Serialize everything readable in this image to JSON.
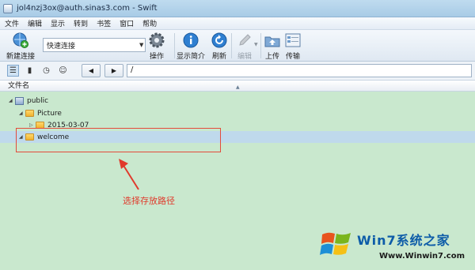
{
  "window": {
    "title": "jol4nzj3ox@auth.sinas3.com - Swift"
  },
  "menu": [
    "文件",
    "编辑",
    "显示",
    "转到",
    "书签",
    "窗口",
    "帮助"
  ],
  "toolbar": {
    "new_connection": "新建连接",
    "quick_connect": "快速连接",
    "action": "操作",
    "show_info": "显示简介",
    "refresh": "刷新",
    "edit": "编辑",
    "upload": "上传",
    "transfers": "传输"
  },
  "navbar": {
    "path": "/"
  },
  "columns": {
    "filename": "文件名"
  },
  "tree": [
    {
      "label": "public",
      "type": "server",
      "expander": "◢"
    },
    {
      "label": "Picture",
      "type": "folder",
      "expander": "◢"
    },
    {
      "label": "2015-03-07",
      "type": "folder",
      "expander": "▷"
    },
    {
      "label": "welcome",
      "type": "folder",
      "expander": "◢"
    }
  ],
  "annotation": "选择存放路径",
  "watermark": {
    "title": "Win7系统之家",
    "url": "Www.Winwin7.com"
  },
  "colors": {
    "annotation": "#e03a2c",
    "browser_bg": "#c9e8ce",
    "selection": "#bfd9ec"
  }
}
